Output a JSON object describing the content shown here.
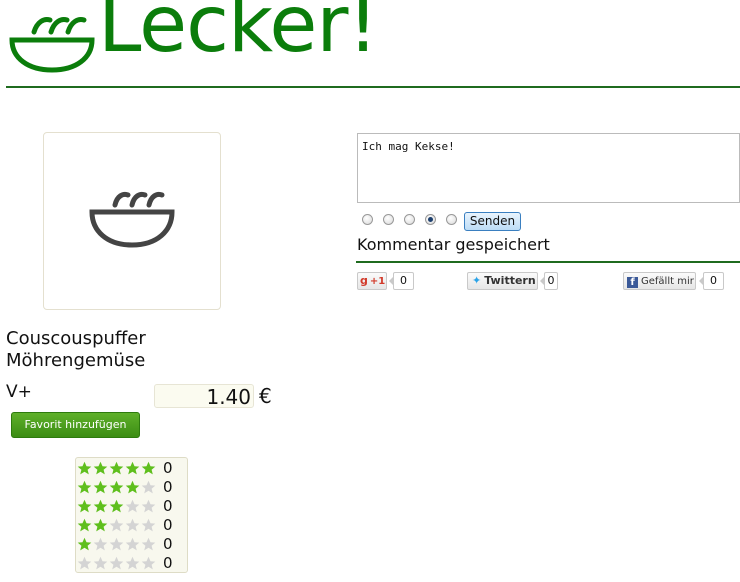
{
  "brand": {
    "name": "Lecker!"
  },
  "dish": {
    "name": "Couscouspuffer Möhrengemüse",
    "diet_tag": "V+",
    "price": "1.40",
    "currency": "€",
    "favorite_label": "Favorit hinzufügen"
  },
  "ratings": [
    {
      "stars": 5,
      "count": "0"
    },
    {
      "stars": 4,
      "count": "0"
    },
    {
      "stars": 3,
      "count": "0"
    },
    {
      "stars": 2,
      "count": "0"
    },
    {
      "stars": 1,
      "count": "0"
    },
    {
      "stars": 0,
      "count": "0"
    }
  ],
  "comment": {
    "text": "Ich mag Kekse!",
    "rating_options": 5,
    "selected_rating": 4,
    "send_label": "Senden",
    "status": "Kommentar gespeichert"
  },
  "social": {
    "gplus": {
      "label": "+1",
      "count": "0"
    },
    "twitter": {
      "label": "Twittern",
      "count": "0"
    },
    "facebook": {
      "label": "Gefällt mir",
      "count": "0"
    }
  },
  "colors": {
    "brand_green": "#0b7d0b",
    "star_on": "#5fbf1d",
    "star_off": "#d4d4d4"
  }
}
